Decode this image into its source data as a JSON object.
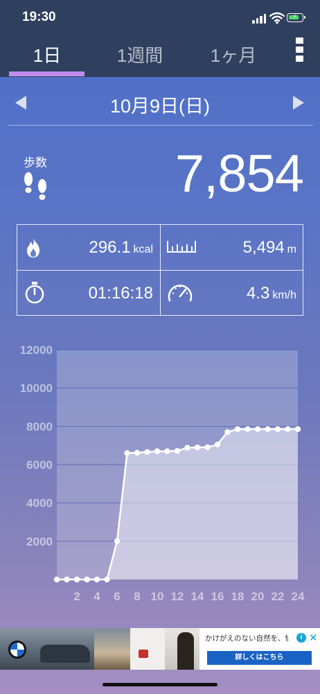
{
  "status_bar": {
    "time": "19:30"
  },
  "tabs": [
    {
      "label": "1日",
      "active": true
    },
    {
      "label": "1週間",
      "active": false
    },
    {
      "label": "1ヶ月",
      "active": false
    }
  ],
  "date_nav": {
    "date": "10月9日(日)"
  },
  "steps": {
    "label": "歩数",
    "value": "7,854"
  },
  "stats": {
    "calories": {
      "value": "296.1",
      "unit": "kcal"
    },
    "distance": {
      "value": "5,494",
      "unit": "m"
    },
    "duration": {
      "value": "01:16:18"
    },
    "speed": {
      "value": "4.3",
      "unit": "km/h"
    }
  },
  "chart_data": {
    "type": "line",
    "x": [
      0,
      1,
      2,
      3,
      4,
      5,
      6,
      7,
      8,
      9,
      10,
      11,
      12,
      13,
      14,
      15,
      16,
      17,
      18,
      19,
      20,
      21,
      22,
      23,
      24
    ],
    "y": [
      0,
      0,
      0,
      0,
      0,
      0,
      2000,
      6600,
      6620,
      6660,
      6700,
      6700,
      6720,
      6880,
      6900,
      6910,
      7050,
      7700,
      7854,
      7854,
      7854,
      7854,
      7854,
      7854,
      7854
    ],
    "x_tick_labels": [
      "2",
      "4",
      "6",
      "8",
      "10",
      "12",
      "14",
      "16",
      "18",
      "20",
      "22",
      "24"
    ],
    "y_tick_labels": [
      "2000",
      "4000",
      "6000",
      "8000",
      "10000",
      "12000"
    ],
    "xlim": [
      0,
      24
    ],
    "ylim": [
      0,
      12000
    ],
    "grid": true
  },
  "ad": {
    "text": "かけがえのない自然を、愉しむ",
    "cta": "詳しくはこちら"
  },
  "colors": {
    "accent_underline": "#c18cf0",
    "header_bg": "#2f3f5e",
    "ad_cta": "#1a63c4"
  }
}
